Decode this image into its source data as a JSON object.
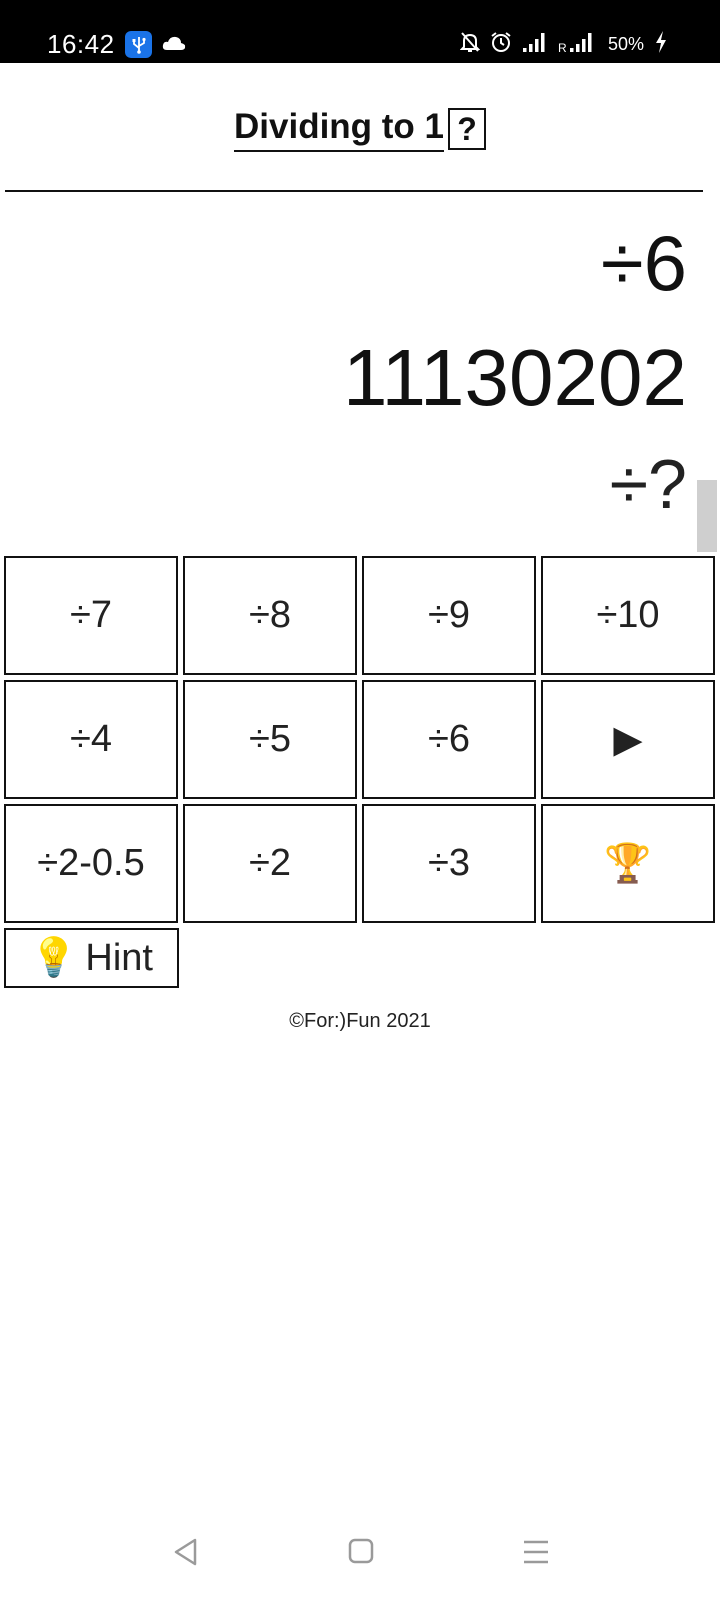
{
  "status_bar": {
    "time": "16:42",
    "battery": "50%",
    "icons": [
      "usb-icon",
      "cloud-icon",
      "mute-icon",
      "alarm-icon",
      "signal-icon",
      "roaming-signal-icon",
      "charging-icon"
    ]
  },
  "header": {
    "title": "Dividing to 1",
    "help_label": "?"
  },
  "display": {
    "target_operation": "÷6",
    "current_number": "11130202",
    "pending_operation": "÷?"
  },
  "keypad": {
    "keys": [
      "÷7",
      "÷8",
      "÷9",
      "÷10",
      "÷4",
      "÷5",
      "÷6",
      "▶",
      "÷2-0.5",
      "÷2",
      "÷3",
      "🏆"
    ]
  },
  "hint": {
    "icon": "💡",
    "label": "Hint"
  },
  "footer": {
    "copyright": "©For:)Fun 2021"
  },
  "nav_bar": {
    "icons": [
      "back-icon",
      "home-icon",
      "recents-icon"
    ]
  }
}
